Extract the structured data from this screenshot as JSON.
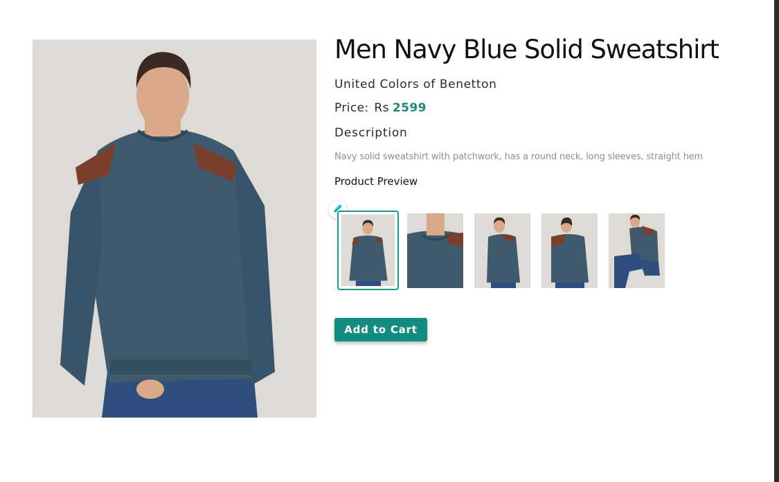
{
  "product": {
    "title": "Men Navy Blue Solid Sweatshirt",
    "brand": "United Colors of Benetton",
    "price_label": "Price:",
    "currency": "Rs",
    "price": "2599",
    "description_heading": "Description",
    "description": "Navy solid sweatshirt with patchwork, has a round neck, long sleeves, straight hem",
    "preview_heading": "Product Preview",
    "add_to_cart_label": "Add to Cart"
  },
  "thumbnails": [
    {
      "view": "front",
      "selected": true
    },
    {
      "view": "neck-closeup",
      "selected": false
    },
    {
      "view": "side",
      "selected": false
    },
    {
      "view": "back",
      "selected": false
    },
    {
      "view": "seated",
      "selected": false
    }
  ],
  "icons": {
    "edit": "pencil-icon"
  },
  "colors": {
    "accent": "#1f8a7b",
    "button": "#128c7e",
    "sweatshirt": "#3e5a6c",
    "patch": "#7a3f2a",
    "jeans": "#2e4f7e"
  }
}
